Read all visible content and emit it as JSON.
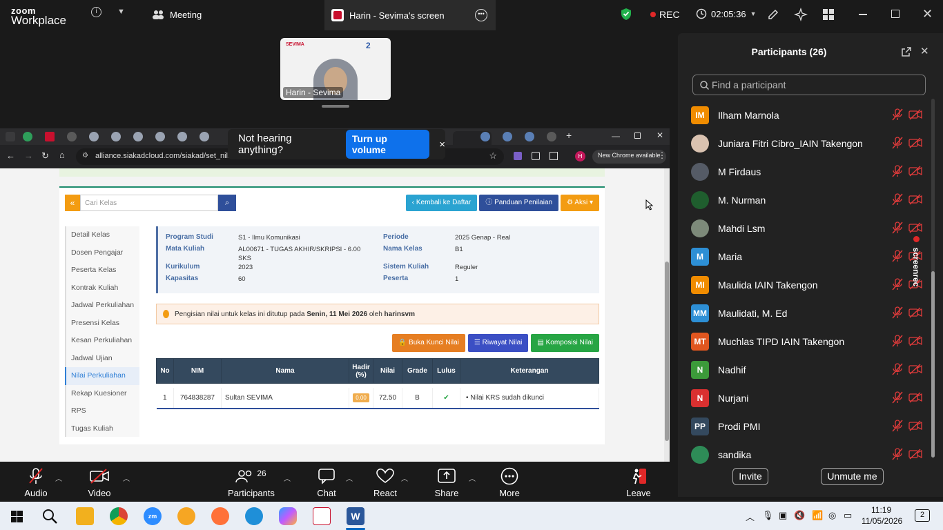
{
  "zoom": {
    "logo_line1": "zoom",
    "logo_line2": "Workplace",
    "meeting_label": "Meeting",
    "share_tab_label": "Harin - Sevima's screen",
    "rec_label": "REC",
    "timer": "02:05:36",
    "thumbnail_name": "Harin - Sevima",
    "thumbnail_brand": "SEVIMA"
  },
  "toast": {
    "message": "Not hearing anything?",
    "button": "Turn up volume",
    "close": "×"
  },
  "browser": {
    "url": "alliance.siakadcloud.com/siakad/set_nilai/170",
    "new_chrome": "New Chrome available",
    "profile_initial": "H"
  },
  "siakad": {
    "search_placeholder": "Cari Kelas",
    "btn_back": "Kembali ke Daftar",
    "btn_guide": "Panduan Penilaian",
    "btn_action": "Aksi",
    "menu": [
      "Detail Kelas",
      "Dosen Pengajar",
      "Peserta Kelas",
      "Kontrak Kuliah",
      "Jadwal Perkuliahan",
      "Presensi Kelas",
      "Kesan Perkuliahan",
      "Jadwal Ujian",
      "Nilai Perkuliahan",
      "Rekap Kuesioner",
      "RPS",
      "Tugas Kuliah"
    ],
    "active_menu": "Nilai Perkuliahan",
    "info": {
      "program_studi_label": "Program Studi",
      "program_studi": "S1 - Ilmu Komunikasi",
      "mata_kuliah_label": "Mata Kuliah",
      "mata_kuliah": "AL00671 - TUGAS AKHIR/SKRIPSI - 6.00",
      "mata_kuliah_2": "SKS",
      "kurikulum_label": "Kurikulum",
      "kurikulum": "2023",
      "kapasitas_label": "Kapasitas",
      "kapasitas": "60",
      "periode_label": "Periode",
      "periode": "2025 Genap - Real",
      "nama_kelas_label": "Nama Kelas",
      "nama_kelas": "B1",
      "sistem_kuliah_label": "Sistem Kuliah",
      "sistem_kuliah": "Reguler",
      "peserta_label": "Peserta",
      "peserta": "1"
    },
    "alert": {
      "prefix": "Pengisian nilai untuk kelas ini ditutup pada ",
      "date": "Senin, 11 Mei 2026",
      "mid": " oleh ",
      "user": "harinsvm"
    },
    "btn_unlock": "Buka Kunci Nilai",
    "btn_history": "Riwayat Nilai",
    "btn_composition": "Komposisi Nilai",
    "table": {
      "headers": [
        "No",
        "NIM",
        "Nama",
        "Hadir (%)",
        "Nilai",
        "Grade",
        "Lulus",
        "Keterangan"
      ],
      "rows": [
        {
          "no": "1",
          "nim": "764838287",
          "nama": "Sultan SEVIMA",
          "hadir": "0.00",
          "nilai": "72.50",
          "grade": "B",
          "lulus": "✔",
          "keterangan": "Nilai KRS sudah dikunci"
        }
      ]
    }
  },
  "participants": {
    "title": "Participants (26)",
    "search_placeholder": "Find a participant",
    "list": [
      {
        "initials": "IM",
        "name": "Ilham Marnola",
        "color": "#f08c00"
      },
      {
        "initials": "",
        "name": "Juniara Fitri Cibro_IAIN Takengon",
        "color": "#d9c2b0"
      },
      {
        "initials": "",
        "name": "M Firdaus",
        "color": "#555b66"
      },
      {
        "initials": "",
        "name": "M. Nurman",
        "color": "#1f5e2e"
      },
      {
        "initials": "",
        "name": "Mahdi Lsm",
        "color": "#7d8a7a"
      },
      {
        "initials": "M",
        "name": "Maria",
        "color": "#2d8fd5"
      },
      {
        "initials": "MI",
        "name": "Maulida IAIN Takengon",
        "color": "#f08c00"
      },
      {
        "initials": "MM",
        "name": "Maulidati,  M. Ed",
        "color": "#2d8fd5"
      },
      {
        "initials": "MT",
        "name": "Muchlas TIPD IAIN Takengon",
        "color": "#e0561f"
      },
      {
        "initials": "N",
        "name": "Nadhif",
        "color": "#3c9a3a"
      },
      {
        "initials": "N",
        "name": "Nurjani",
        "color": "#d93030"
      },
      {
        "initials": "PP",
        "name": "Prodi PMI",
        "color": "#34495e"
      },
      {
        "initials": "",
        "name": "sandika",
        "color": "#2e8b57"
      }
    ],
    "invite": "Invite",
    "unmute_me": "Unmute me",
    "screenrec": "screenrec"
  },
  "toolbar": {
    "audio": "Audio",
    "video": "Video",
    "participants": "Participants",
    "participants_count": "26",
    "chat": "Chat",
    "react": "React",
    "share": "Share",
    "more": "More",
    "leave": "Leave"
  },
  "taskbar": {
    "time": "11:19",
    "date": "11/05/2026",
    "notif": "2"
  }
}
